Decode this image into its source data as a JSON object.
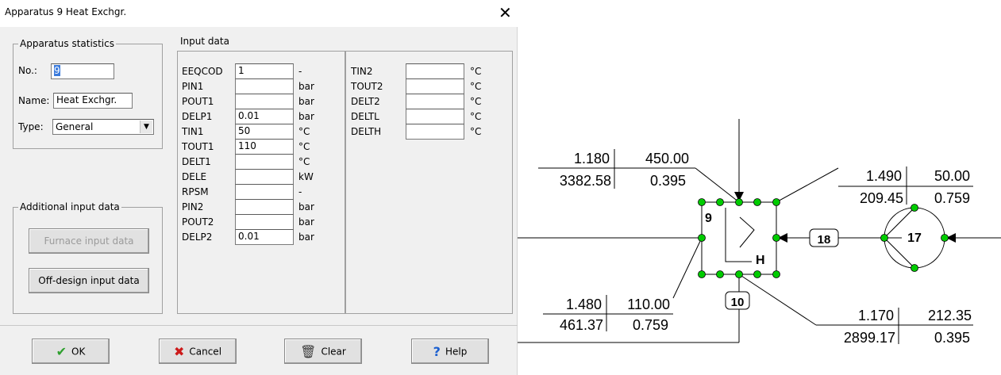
{
  "window": {
    "title": "Apparatus 9  Heat Exchgr.",
    "close_glyph": "✕"
  },
  "stats": {
    "legend": "Apparatus statistics",
    "no_label": "No.:",
    "no_value": "9",
    "name_label": "Name:",
    "name_value": "Heat Exchgr.",
    "type_label": "Type:",
    "type_value": "General"
  },
  "additional": {
    "legend": "Additional input data",
    "furnace_label": "Furnace input data",
    "offdesign_label": "Off-design input data"
  },
  "input_data": {
    "legend": "Input data",
    "left_rows": [
      {
        "label": "EEQCOD",
        "value": "1",
        "unit": "-"
      },
      {
        "label": "PIN1",
        "value": "",
        "unit": "bar"
      },
      {
        "label": "POUT1",
        "value": "",
        "unit": "bar"
      },
      {
        "label": "DELP1",
        "value": "0.01",
        "unit": "bar"
      },
      {
        "label": "TIN1",
        "value": "50",
        "unit": "°C"
      },
      {
        "label": "TOUT1",
        "value": "110",
        "unit": "°C"
      },
      {
        "label": "DELT1",
        "value": "",
        "unit": "°C"
      },
      {
        "label": "DELE",
        "value": "",
        "unit": "kW"
      },
      {
        "label": "RPSM",
        "value": "",
        "unit": "-"
      },
      {
        "label": "PIN2",
        "value": "",
        "unit": "bar"
      },
      {
        "label": "POUT2",
        "value": "",
        "unit": "bar"
      },
      {
        "label": "DELP2",
        "value": "0.01",
        "unit": "bar"
      }
    ],
    "right_rows": [
      {
        "label": "TIN2",
        "value": "",
        "unit": "°C"
      },
      {
        "label": "TOUT2",
        "value": "",
        "unit": "°C"
      },
      {
        "label": "DELT2",
        "value": "",
        "unit": "°C"
      },
      {
        "label": "DELTL",
        "value": "",
        "unit": "°C"
      },
      {
        "label": "DELTH",
        "value": "",
        "unit": "°C"
      }
    ]
  },
  "buttons": {
    "ok_label": "OK",
    "cancel_label": "Cancel",
    "clear_label": "Clear",
    "help_label": "Help",
    "ok_icon": "check-icon",
    "cancel_icon": "x-icon",
    "clear_icon": "trash-icon",
    "help_icon": "help-icon"
  },
  "diagram": {
    "apparatus_no": "9",
    "apparatus_type": "H",
    "pipe_labels": [
      "18",
      "10"
    ],
    "node_no": "17",
    "stream_top_left": {
      "p": "1.180",
      "t": "450.00",
      "h": "3382.58",
      "x": "0.395"
    },
    "stream_top_right": {
      "p": "1.490",
      "t": "50.00",
      "h": "209.45",
      "x": "0.759"
    },
    "stream_bottom_left": {
      "p": "1.480",
      "t": "110.00",
      "h": "461.37",
      "x": "0.759"
    },
    "stream_bottom_right": {
      "p": "1.170",
      "t": "212.35",
      "h": "2899.17",
      "x": "0.395"
    },
    "colors": {
      "node": "#00cc00",
      "line": "#000000"
    }
  }
}
